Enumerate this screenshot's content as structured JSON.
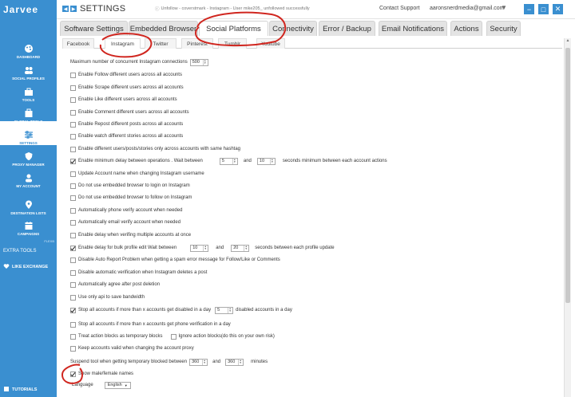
{
  "app": {
    "logo": "Jarvee",
    "title": "SETTINGS",
    "status": "Unfollow - coverstmark - Instagram - User mike205_ unfollowed successfully",
    "contact": "Contact Support",
    "email": "aaronsnerdmedia@gmail.com"
  },
  "sidebar": {
    "items": [
      {
        "label": "DASHBOARD",
        "icon": "palette-icon"
      },
      {
        "label": "SOCIAL PROFILES",
        "icon": "user-group-icon"
      },
      {
        "label": "TOOLS",
        "icon": "toolbox-icon"
      },
      {
        "label": "GLOBAL TOOLS",
        "icon": "briefcase-icon"
      },
      {
        "label": "SETTINGS",
        "icon": "sliders-icon"
      },
      {
        "label": "PROXY MANAGER",
        "icon": "shield-icon"
      },
      {
        "label": "MY ACCOUNT",
        "icon": "person-icon"
      },
      {
        "label": "DESTINATION LISTS",
        "icon": "location-pin-icon"
      },
      {
        "label": "CAMPAIGNS",
        "icon": "calendar-icon"
      }
    ],
    "flex_label": "FLEXB",
    "extra_tools": "EXTRA TOOLS",
    "likes": "LIKE EXCHANGE",
    "tutorials": "TUTORIALS"
  },
  "tabs": [
    "Software Settings",
    "Embedded Browser",
    "Social Platforms",
    "Connectivity",
    "Error / Backup",
    "Email Notifications",
    "Actions",
    "Security"
  ],
  "subtabs": [
    "Facebook",
    "Instagram",
    "Twitter",
    "Pinterest",
    "Tumblr",
    "Youtube"
  ],
  "settings": {
    "max_connections": {
      "label": "Maximum number of concurrent Instagram connections",
      "value": "500"
    },
    "r_follow": "Enable Follow different users across all accounts",
    "r_scrape": "Enable Scrape different users across all accounts",
    "r_like": "Enable Like different users across all accounts",
    "r_comment": "Enable Comment different users across all accounts",
    "r_repost": "Enable Repost different posts across all accounts",
    "r_watch": "Enable watch different stories across all accounts",
    "r_hashtag": "Enable different users/posts/stories only across accounts with same hashtag",
    "min_delay": {
      "label": "Enable minimum delay between operations . Wait between",
      "from": "5",
      "and": "and",
      "to": "10",
      "suffix": "seconds minimum between each account actions"
    },
    "r_update": "Update Account name when changing Instagram username",
    "r_login": "Do not use embedded browser to login on Instagram",
    "r_follow_browser": "Do not use embedded browser to follow on Instagram",
    "r_phone": "Automatically phone verify account when needed",
    "r_email": "Automatically email verify account when needed",
    "r_delay_verify": "Enable delay when verifing multiple accounts at once",
    "bulk_delay": {
      "label": "Enable delay for bulk profile edit  Wait between",
      "from": "10",
      "and": "and",
      "to": "20",
      "suffix": "seconds between each profile update"
    },
    "r_autoreport": "Disable Auto Report Problem when getting a spam error message for Follow/Like or Comments",
    "r_autoverify": "Disable automatic verification when Instagram deletes a post",
    "r_agree": "Automatically agree after post deletion",
    "r_api": "Use only api to save bandwidth",
    "stop_disabled": {
      "label": "Stop all accounts if more than x accounts get disabled in a day",
      "value": "5",
      "suffix": "disabled accounts in a day"
    },
    "r_phone_ver": "Stop all accounts if more than x accounts get phone verification in a day",
    "r_treat": "Treat action blocks as temporary blocks",
    "r_ignore": "Ignore action blocks(do this on your own risk)",
    "r_keep": "Keep accounts valid when changing the account proxy",
    "suspend": {
      "label": "Suspend tool when getting temporary blocked between",
      "from": "360",
      "and": "and",
      "to": "360",
      "suffix": "minutes"
    },
    "r_gender": "Show male/female names",
    "language": {
      "label": "Language",
      "value": "English"
    }
  },
  "colors": {
    "accent": "#3a8fd0",
    "annotation": "#d0261f"
  }
}
